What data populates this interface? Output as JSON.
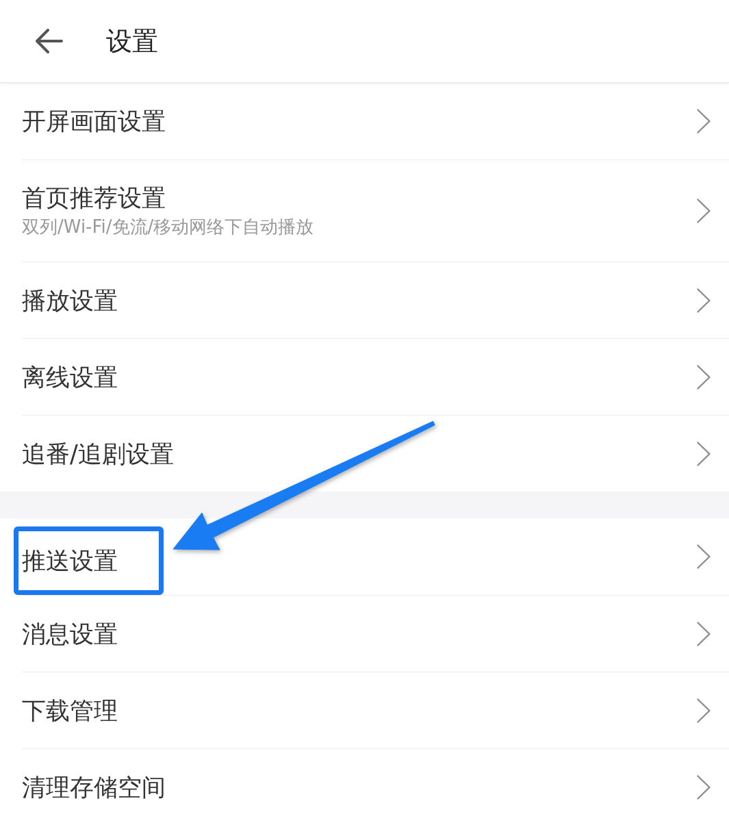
{
  "header": {
    "title": "设置"
  },
  "sections": [
    {
      "items": [
        {
          "label": "开屏画面设置",
          "highlighted": false
        },
        {
          "label": "首页推荐设置",
          "description": "双列/Wi-Fi/免流/移动网络下自动播放",
          "highlighted": false
        },
        {
          "label": "播放设置",
          "highlighted": false
        },
        {
          "label": "离线设置",
          "highlighted": false
        },
        {
          "label": "追番/追剧设置",
          "highlighted": false
        }
      ]
    },
    {
      "items": [
        {
          "label": "推送设置",
          "highlighted": true
        },
        {
          "label": "消息设置",
          "highlighted": false
        },
        {
          "label": "下载管理",
          "highlighted": false
        },
        {
          "label": "清理存储空间",
          "highlighted": false
        }
      ]
    }
  ]
}
